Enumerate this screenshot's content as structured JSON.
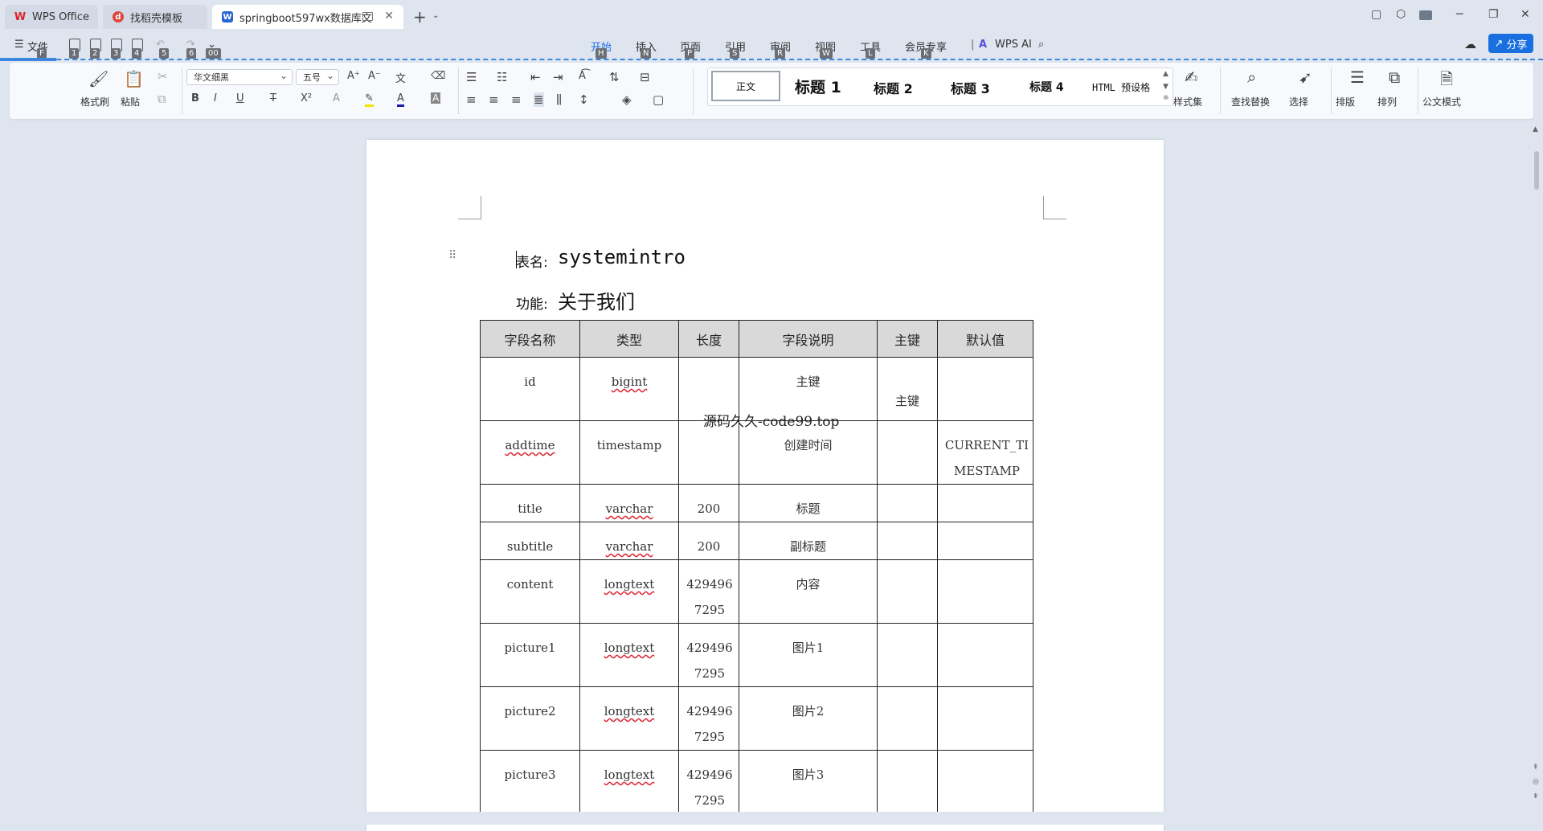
{
  "tabs": [
    {
      "label": "WPS Office"
    },
    {
      "label": "找稻壳模板"
    },
    {
      "label": "springboot597wx数据库文"
    }
  ],
  "menu": {
    "file": "文件",
    "quick_keys": [
      "F",
      "1",
      "2",
      "3",
      "4",
      "5",
      "6",
      "00"
    ],
    "items": [
      {
        "label": "开始",
        "key": "H"
      },
      {
        "label": "插入",
        "key": "N"
      },
      {
        "label": "页面",
        "key": "P"
      },
      {
        "label": "引用",
        "key": "S"
      },
      {
        "label": "审阅",
        "key": "R"
      },
      {
        "label": "视图",
        "key": "W"
      },
      {
        "label": "工具",
        "key": "L"
      },
      {
        "label": "会员专享",
        "key": "K"
      }
    ],
    "wps_ai": "WPS AI",
    "share": "分享"
  },
  "ribbon": {
    "format_painter": "格式刷",
    "paste": "粘贴",
    "font_name": "华文细黑",
    "font_size": "五号",
    "styles": [
      "正文",
      "标题 1",
      "标题 2",
      "标题 3",
      "标题 4",
      "HTML 预设格"
    ],
    "style_set": "样式集",
    "find_replace": "查找替换",
    "select": "选择",
    "layout": "排版",
    "arrange": "排列",
    "official_mode": "公文模式"
  },
  "document": {
    "table_name_label": "表名:",
    "table_name": "systemintro",
    "function_label": "功能:",
    "function_value": "关于我们",
    "watermark": "源码久久-code99.top",
    "headers": [
      "字段名称",
      "类型",
      "长度",
      "字段说明",
      "主键",
      "默认值"
    ],
    "rows": [
      {
        "name": "id",
        "type": "bigint",
        "length": "",
        "desc": "主键",
        "pk": "主键",
        "default": ""
      },
      {
        "name": "addtime",
        "type": "timestamp",
        "length": "",
        "desc": "创建时间",
        "pk": "",
        "default": "CURRENT_TIMESTAMP"
      },
      {
        "name": "title",
        "type": "varchar",
        "length": "200",
        "desc": "标题",
        "pk": "",
        "default": ""
      },
      {
        "name": "subtitle",
        "type": "varchar",
        "length": "200",
        "desc": "副标题",
        "pk": "",
        "default": ""
      },
      {
        "name": "content",
        "type": "longtext",
        "length": "4294967295",
        "desc": "内容",
        "pk": "",
        "default": ""
      },
      {
        "name": "picture1",
        "type": "longtext",
        "length": "4294967295",
        "desc": "图片1",
        "pk": "",
        "default": ""
      },
      {
        "name": "picture2",
        "type": "longtext",
        "length": "4294967295",
        "desc": "图片2",
        "pk": "",
        "default": ""
      },
      {
        "name": "picture3",
        "type": "longtext",
        "length": "4294967295",
        "desc": "图片3",
        "pk": "",
        "default": ""
      }
    ]
  },
  "colors": {
    "accent": "#1a6fe0",
    "chrome": "#dfe5ef",
    "header_fill": "#d9d9d9",
    "spell_underline": "#dd2233"
  }
}
